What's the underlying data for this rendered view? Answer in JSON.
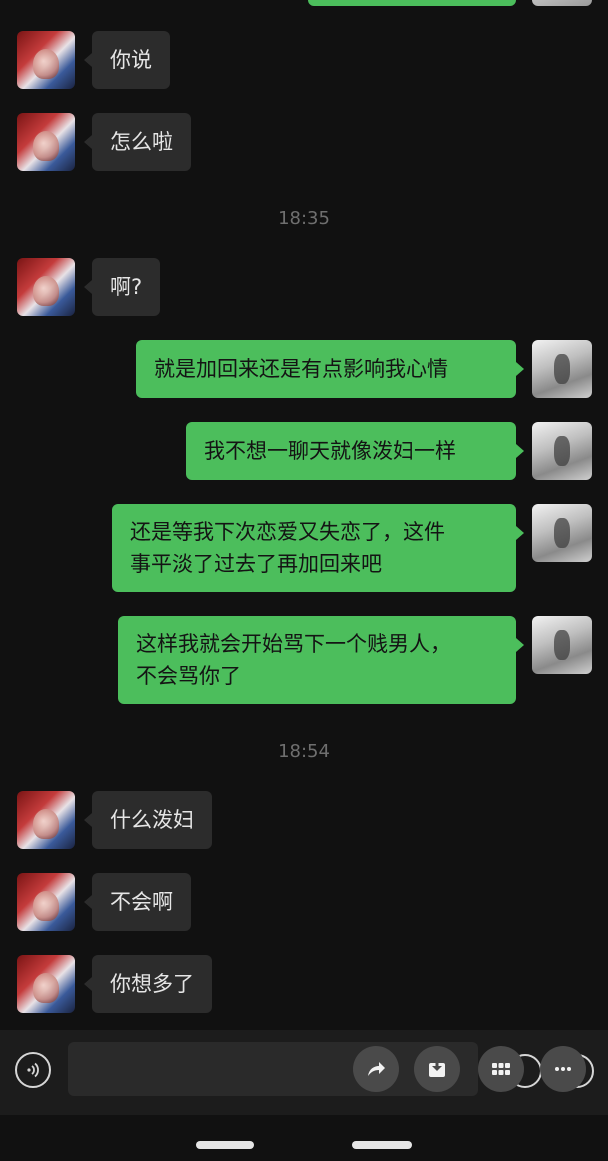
{
  "timestamps": {
    "t1": "18:35",
    "t2": "18:54"
  },
  "messages": {
    "m1": "你说",
    "m2": "怎么啦",
    "m3": "啊?",
    "m4": "就是加回来还是有点影响我心情",
    "m5": "我不想一聊天就像泼妇一样",
    "m6_line1": "还是等我下次恋爱又失恋了，这件",
    "m6_line2": "事平淡了过去了再加回来吧",
    "m7_line1": "这样我就会开始骂下一个贱男人，",
    "m7_line2": "不会骂你了",
    "m8": "什么泼妇",
    "m9": "不会啊",
    "m10": "你想多了"
  },
  "colors": {
    "background": "#111111",
    "incoming_bubble": "#2c2c2c",
    "outgoing_bubble": "#4cbe5c",
    "timestamp": "#6f6f6f"
  },
  "icons": {
    "voice": "voice-icon",
    "share": "share-icon",
    "save": "download-icon",
    "grid": "grid-icon",
    "more": "more-icon",
    "emoji": "emoji-icon",
    "plus": "plus-icon"
  }
}
